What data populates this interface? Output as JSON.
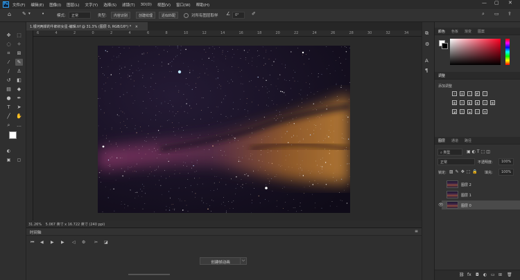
{
  "menubar": {
    "app_logo": "Ps",
    "items": [
      "文件(F)",
      "编辑(E)",
      "图像(I)",
      "图层(L)",
      "文字(Y)",
      "选择(S)",
      "滤镜(T)",
      "3D(D)",
      "视图(V)",
      "窗口(W)",
      "帮助(H)"
    ],
    "window_controls": {
      "minimize": "—",
      "maximize": "▢",
      "close": "✕"
    }
  },
  "options_bar": {
    "mode_label": "模式:",
    "mode_value": "正常",
    "type_label": "类型:",
    "buttons": [
      "内容识别",
      "创建纹理",
      "近似匹配"
    ],
    "sample_all_layers": "对所有图层取样",
    "angle_value": "0°"
  },
  "document": {
    "tab_title": "1.银河两岸的牛郎织女星-编辑.tif @ 31.3% (图层 0, RGB/16*) *",
    "close": "×"
  },
  "ruler_ticks": [
    "6",
    "4",
    "2",
    "0",
    "2",
    "4",
    "6",
    "8",
    "10",
    "12",
    "14",
    "16",
    "18",
    "20",
    "22",
    "24",
    "26",
    "28",
    "30",
    "32",
    "34"
  ],
  "status": {
    "zoom": "31.26%",
    "info": "5.067 英寸 x 16.722 英寸 (240 ppi)"
  },
  "timeline": {
    "title": "时间轴",
    "create_button": "创建帧动画",
    "dropdown_arrow": "⌵"
  },
  "color_panel": {
    "tabs": [
      "颜色",
      "色板",
      "渐变",
      "图案"
    ]
  },
  "adjustments_panel": {
    "tab": "调整",
    "subtitle": "添加调整"
  },
  "layers_panel": {
    "tabs": [
      "图层",
      "通道",
      "路径"
    ],
    "filter_type": "类型",
    "blend_mode": "正常",
    "opacity_label": "不透明度:",
    "opacity_value": "100%",
    "lock_label": "锁定:",
    "fill_label": "填充:",
    "fill_value": "100%",
    "layers": [
      {
        "name": "图层 2",
        "visible": false
      },
      {
        "name": "图层 1",
        "visible": false
      },
      {
        "name": "图层 0",
        "visible": true
      }
    ]
  },
  "colors": {
    "accent": "#31a8ff",
    "panel": "#323232",
    "canvas_bg": "#2a2a2a"
  }
}
